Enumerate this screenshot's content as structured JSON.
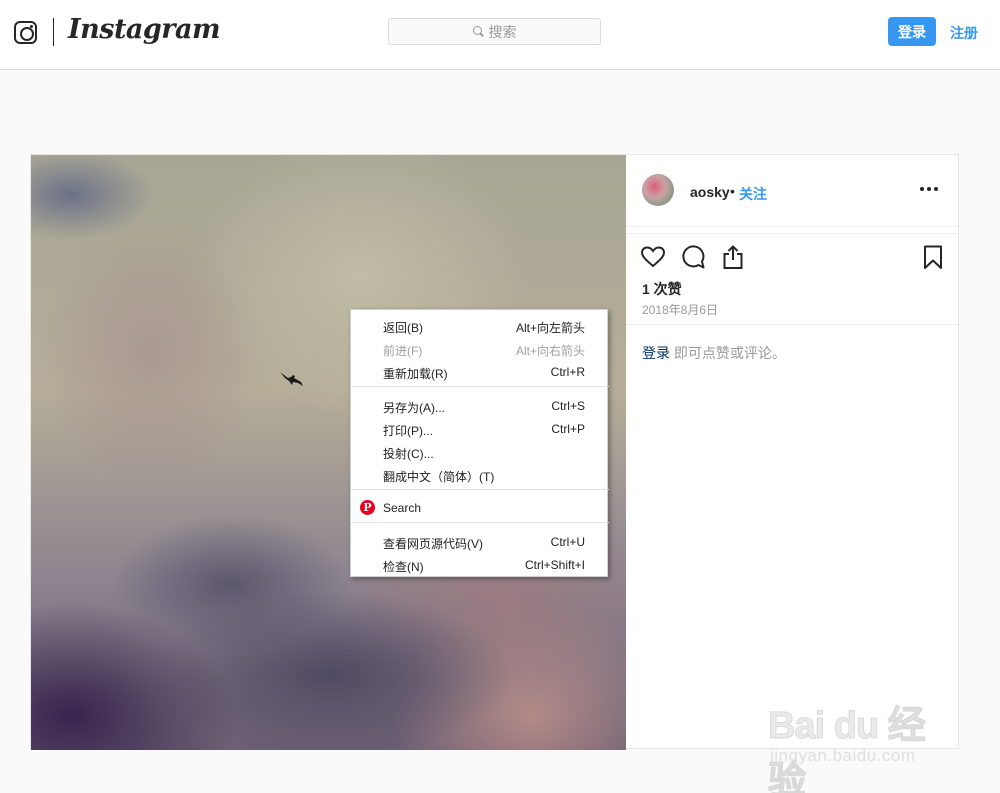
{
  "header": {
    "logo_text": "Instagram",
    "search_placeholder": "搜索",
    "login_label": "登录",
    "signup_label": "注册"
  },
  "post": {
    "username": "aosky",
    "separator": "•",
    "follow_label": "关注",
    "likes": "1 次赞",
    "date": "2018年8月6日",
    "comment_login": "登录",
    "comment_hint": " 即可点赞或评论。"
  },
  "context_menu": {
    "items": [
      {
        "label": "返回(B)",
        "shortcut": "Alt+向左箭头",
        "enabled": true
      },
      {
        "label": "前进(F)",
        "shortcut": "Alt+向右箭头",
        "enabled": false
      },
      {
        "label": "重新加载(R)",
        "shortcut": "Ctrl+R",
        "enabled": true
      },
      {
        "label": "另存为(A)...",
        "shortcut": "Ctrl+S",
        "enabled": true
      },
      {
        "label": "打印(P)...",
        "shortcut": "Ctrl+P",
        "enabled": true
      },
      {
        "label": "投射(C)...",
        "shortcut": "",
        "enabled": true
      },
      {
        "label": "翻成中文（简体）(T)",
        "shortcut": "",
        "enabled": true
      },
      {
        "label": "Search",
        "shortcut": "",
        "enabled": true,
        "icon": "pinterest-icon"
      },
      {
        "label": "查看网页源代码(V)",
        "shortcut": "Ctrl+U",
        "enabled": true
      },
      {
        "label": "检查(N)",
        "shortcut": "Ctrl+Shift+I",
        "enabled": true
      }
    ]
  },
  "watermark": {
    "main": "Bai du 经验",
    "sub": "jingyan.baidu.com"
  },
  "colors": {
    "accent": "#3897f0",
    "text": "#262626",
    "muted": "#999999",
    "pinterest": "#e60023"
  }
}
